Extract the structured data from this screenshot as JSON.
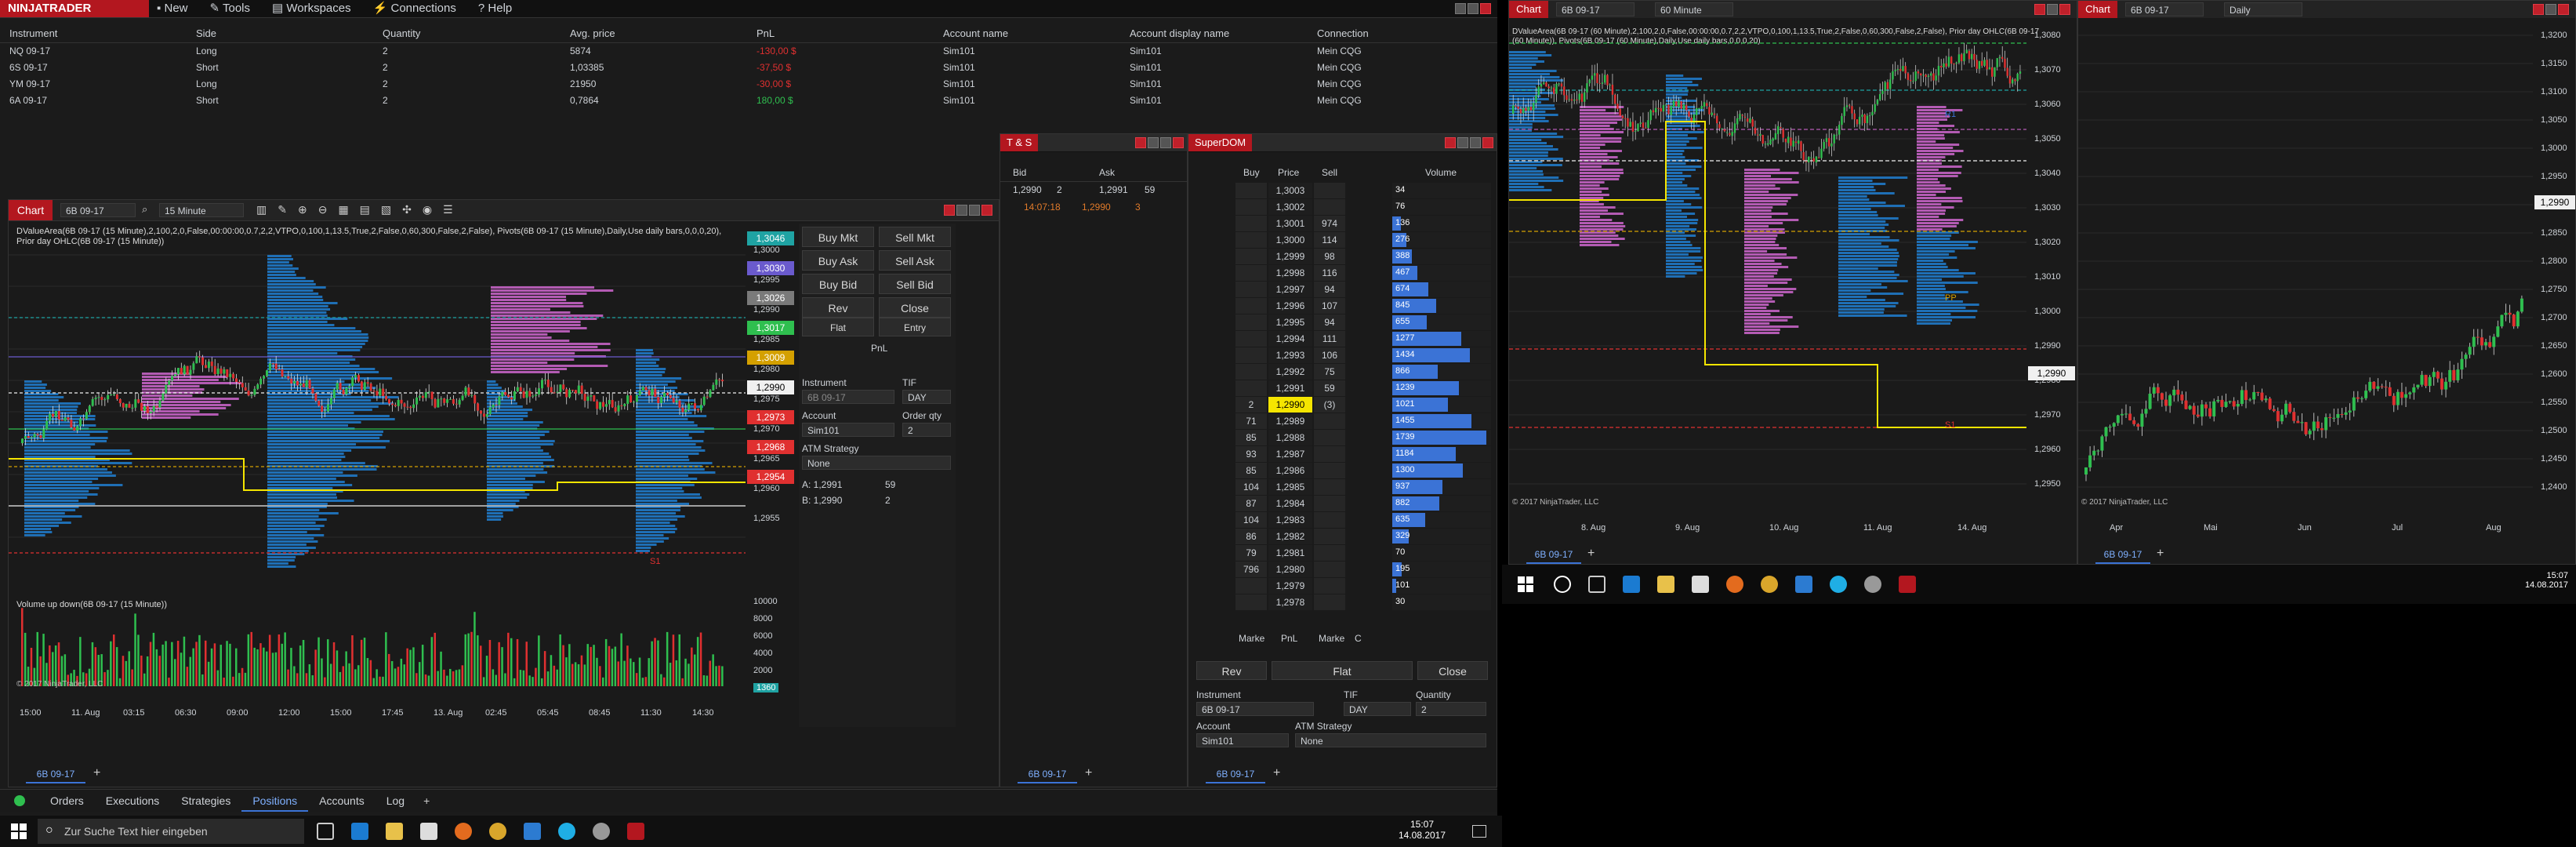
{
  "colors": {
    "brand_red": "#b3171f",
    "profit": "#2fbf4f",
    "loss": "#e03030",
    "ask_blue": "#3b73d6",
    "bid_gray": "#8b8b8b",
    "highlight_yellow": "#f5e500"
  },
  "control_center": {
    "logo": "NINJATRADER",
    "menu": [
      "New",
      "Tools",
      "Workspaces",
      "Connections",
      "Help"
    ],
    "positions_headers": [
      "Instrument",
      "Side",
      "Quantity",
      "Avg. price",
      "PnL",
      "Account name",
      "Account display name",
      "Connection"
    ],
    "positions": [
      {
        "instrument": "NQ 09-17",
        "side": "Long",
        "qty": "2",
        "avg": "5874",
        "pnl": "-130,00 $",
        "account": "Sim101",
        "display": "Sim101",
        "conn": "Mein CQG",
        "pnl_color": "#e03030"
      },
      {
        "instrument": "6S 09-17",
        "side": "Short",
        "qty": "2",
        "avg": "1,03385",
        "pnl": "-37,50 $",
        "account": "Sim101",
        "display": "Sim101",
        "conn": "Mein CQG",
        "pnl_color": "#e03030"
      },
      {
        "instrument": "YM 09-17",
        "side": "Long",
        "qty": "2",
        "avg": "21950",
        "pnl": "-30,00 $",
        "account": "Sim101",
        "display": "Sim101",
        "conn": "Mein CQG",
        "pnl_color": "#e03030"
      },
      {
        "instrument": "6A 09-17",
        "side": "Short",
        "qty": "2",
        "avg": "0,7864",
        "pnl": "180,00 $",
        "account": "Sim101",
        "display": "Sim101",
        "conn": "Mein CQG",
        "pnl_color": "#2fbf4f"
      }
    ],
    "bottom_tabs": [
      "Orders",
      "Executions",
      "Strategies",
      "Positions",
      "Accounts",
      "Log"
    ],
    "active_tab": "Positions"
  },
  "chart1": {
    "tab": "Chart",
    "instrument": "6B 09-17",
    "interval": "15 Minute",
    "indicator_text": "DValueArea(6B 09-17 (15 Minute),2,100,2,0,False,00:00:00,0.7,2,2,VTPO,0,100,1,13.5,True,2,False,0,60,300,False,2,False), Pivots(6B 09-17 (15 Minute),Daily,Use daily bars,0,0,0,20), Prior day OHLC(6B 09-17 (15 Minute))",
    "volume_title": "Volume up down(6B 09-17 (15 Minute))",
    "copyright": "© 2017 NinjaTrader, LLC",
    "price_tags": [
      {
        "label": "1,3046",
        "color": "#1fa3a3"
      },
      {
        "label": "1,3030",
        "color": "#6a5acd"
      },
      {
        "label": "1,3026",
        "color": "#7a7a7a"
      },
      {
        "label": "1,3017",
        "color": "#2fbf4f"
      },
      {
        "label": "1,3009",
        "color": "#d4a000"
      },
      {
        "label": "1,2990",
        "color": "#f0f0f0"
      },
      {
        "label": "1,2973",
        "color": "#e03030"
      },
      {
        "label": "1,2968",
        "color": "#e03030"
      },
      {
        "label": "1,2954",
        "color": "#e03030"
      }
    ],
    "axis_prices": [
      "1,3000",
      "1,2995",
      "1,2990",
      "1,2985",
      "1,2980",
      "1,2975",
      "1,2970",
      "1,2965",
      "1,2960",
      "1,2955"
    ],
    "vol_axis": [
      "10000",
      "8000",
      "6000",
      "4000",
      "2000",
      "1360"
    ],
    "time_axis": [
      "15:00",
      "11. Aug",
      "03:15",
      "06:30",
      "09:00",
      "12:00",
      "15:00",
      "17:45",
      "13. Aug",
      "02:45",
      "05:45",
      "08:45",
      "11:30",
      "14:30"
    ],
    "pivot_labels": [
      "S1"
    ],
    "bottom_tab": "6B 09-17",
    "chart_trader": {
      "buttons": [
        "Buy Mkt",
        "Sell Mkt",
        "Buy Ask",
        "Sell Ask",
        "Buy Bid",
        "Sell Bid",
        "Rev",
        "Close"
      ],
      "sub": [
        "Flat",
        "Entry"
      ],
      "pnl_label": "PnL",
      "instrument_label": "Instrument",
      "instrument": "6B 09-17",
      "tif_label": "TIF",
      "tif": "DAY",
      "account_label": "Account",
      "account": "Sim101",
      "qty_label": "Order qty",
      "qty": "2",
      "atm_label": "ATM Strategy",
      "atm": "None",
      "ask_line": "A:  1,2991",
      "ask_size": "59",
      "bid_line": "B:  1,2990",
      "bid_size": "2"
    }
  },
  "ts": {
    "title": "T & S",
    "bid_header": "Bid",
    "ask_header": "Ask",
    "bid_price": "1,2990",
    "bid_size": "2",
    "ask_price": "1,2991",
    "ask_size": "59",
    "last_time": "14:07:18",
    "last_price": "1,2990",
    "last_size": "3",
    "bottom_tab": "6B 09-17"
  },
  "superdom": {
    "title": "SuperDOM",
    "headers": [
      "Buy",
      "Price",
      "Sell",
      "Volume"
    ],
    "rows": [
      {
        "buy": "",
        "price": "1,3003",
        "sell": "",
        "vol": "34",
        "bar": 0.0
      },
      {
        "buy": "",
        "price": "1,3002",
        "sell": "",
        "vol": "76",
        "bar": 0.0
      },
      {
        "buy": "",
        "price": "1,3001",
        "sell": "974",
        "vol": "136",
        "bar": 0.06
      },
      {
        "buy": "",
        "price": "1,3000",
        "sell": "114",
        "vol": "276",
        "bar": 0.1
      },
      {
        "buy": "",
        "price": "1,2999",
        "sell": "98",
        "vol": "388",
        "bar": 0.14
      },
      {
        "buy": "",
        "price": "1,2998",
        "sell": "116",
        "vol": "467",
        "bar": 0.18
      },
      {
        "buy": "",
        "price": "1,2997",
        "sell": "94",
        "vol": "674",
        "bar": 0.26
      },
      {
        "buy": "",
        "price": "1,2996",
        "sell": "107",
        "vol": "845",
        "bar": 0.32
      },
      {
        "buy": "",
        "price": "1,2995",
        "sell": "94",
        "vol": "655",
        "bar": 0.25
      },
      {
        "buy": "",
        "price": "1,2994",
        "sell": "111",
        "vol": "1277",
        "bar": 0.5
      },
      {
        "buy": "",
        "price": "1,2993",
        "sell": "106",
        "vol": "1434",
        "bar": 0.56
      },
      {
        "buy": "",
        "price": "1,2992",
        "sell": "75",
        "vol": "866",
        "bar": 0.33
      },
      {
        "buy": "",
        "price": "1,2991",
        "sell": "59",
        "vol": "1239",
        "bar": 0.48
      },
      {
        "buy": "2",
        "price": "1,2990",
        "sell": "(3)",
        "vol": "1021",
        "bar": 0.4
      },
      {
        "buy": "71",
        "price": "1,2989",
        "sell": "",
        "vol": "1455",
        "bar": 0.57
      },
      {
        "buy": "85",
        "price": "1,2988",
        "sell": "",
        "vol": "1739",
        "bar": 0.68
      },
      {
        "buy": "93",
        "price": "1,2987",
        "sell": "",
        "vol": "1184",
        "bar": 0.46
      },
      {
        "buy": "85",
        "price": "1,2986",
        "sell": "",
        "vol": "1300",
        "bar": 0.51
      },
      {
        "buy": "104",
        "price": "1,2985",
        "sell": "",
        "vol": "937",
        "bar": 0.36
      },
      {
        "buy": "87",
        "price": "1,2984",
        "sell": "",
        "vol": "882",
        "bar": 0.34
      },
      {
        "buy": "104",
        "price": "1,2983",
        "sell": "",
        "vol": "635",
        "bar": 0.24
      },
      {
        "buy": "86",
        "price": "1,2982",
        "sell": "",
        "vol": "329",
        "bar": 0.12
      },
      {
        "buy": "79",
        "price": "1,2981",
        "sell": "",
        "vol": "70",
        "bar": 0.0
      },
      {
        "buy": "796",
        "price": "1,2980",
        "sell": "",
        "vol": "195",
        "bar": 0.07
      },
      {
        "buy": "",
        "price": "1,2979",
        "sell": "",
        "vol": "101",
        "bar": 0.03
      },
      {
        "buy": "",
        "price": "1,2978",
        "sell": "",
        "vol": "30",
        "bar": 0.0
      }
    ],
    "footer": [
      "Marke",
      "PnL",
      "Marke",
      "C"
    ],
    "rev": "Rev",
    "flat": "Flat",
    "close": "Close",
    "instrument_label": "Instrument",
    "instrument": "6B 09-17",
    "tif_label": "TIF",
    "tif": "DAY",
    "qty_label": "Quantity",
    "qty": "2",
    "account_label": "Account",
    "account": "Sim101",
    "atm_label": "ATM Strategy",
    "atm": "None",
    "bottom_tab": "6B 09-17"
  },
  "chart2": {
    "tab": "Chart",
    "instrument": "6B 09-17",
    "interval": "60 Minute",
    "indicator_text": "DValueArea(6B 09-17 (60 Minute),2,100,2,0,False,00:00:00,0.7,2,2,VTPO,0,100,1,13.5,True,2,False,0,60,300,False,2,False), Prior day OHLC(6B 09-17 (60 Minute)), Pivots(6B 09-17 (60 Minute),Daily,Use daily bars,0,0,0,20)",
    "axis": [
      "1,3080",
      "1,3070",
      "1,3060",
      "1,3050",
      "1,3040",
      "1,3030",
      "1,3020",
      "1,3010",
      "1,3000",
      "1,2990",
      "1,2980",
      "1,2970",
      "1,2960",
      "1,2950"
    ],
    "time_axis": [
      "8. Aug",
      "9. Aug",
      "10. Aug",
      "11. Aug",
      "14. Aug"
    ],
    "labels": [
      "R1",
      "PP",
      "S1"
    ],
    "last_price": "1,2990",
    "copyright": "© 2017 NinjaTrader, LLC",
    "bottom_tab": "6B 09-17"
  },
  "chart3": {
    "tab": "Chart",
    "instrument": "6B 09-17",
    "interval": "Daily",
    "axis": [
      "1,3200",
      "1,3150",
      "1,3100",
      "1,3050",
      "1,3000",
      "1,2950",
      "1,2900",
      "1,2850",
      "1,2800",
      "1,2750",
      "1,2700",
      "1,2650",
      "1,2600",
      "1,2550",
      "1,2500",
      "1,2450",
      "1,2400"
    ],
    "last_price": "1,2990",
    "time_axis": [
      "Apr",
      "Mai",
      "Jun",
      "Jul",
      "Aug"
    ],
    "copyright": "© 2017 NinjaTrader, LLC",
    "bottom_tab": "6B 09-17"
  },
  "taskbar": {
    "search_placeholder": "Zur Suche Text hier eingeben",
    "time": "15:07",
    "date": "14.08.2017",
    "time2": "15:07",
    "date2": "14.08.2017"
  }
}
